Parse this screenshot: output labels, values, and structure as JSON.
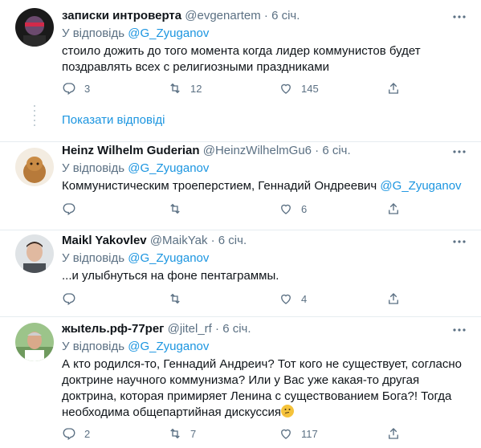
{
  "tweets": [
    {
      "name": "записки интроверта",
      "handle": "@evgenartem",
      "time": "6 січ.",
      "reply_prefix": "У відповідь",
      "reply_to": "@G_Zyuganov",
      "text_lines": [
        "стоило дожить до того момента когда лидер коммунистов будет",
        "поздравлять всех с религиозными праздниками"
      ],
      "replies": "3",
      "retweets": "12",
      "likes": "145"
    },
    {
      "name": "Heinz Wilhelm Guderian",
      "handle": "@HeinzWilhelmGu6",
      "time": "6 січ.",
      "reply_prefix": "У відповідь",
      "reply_to": "@G_Zyuganov",
      "text_lines": [
        "Коммунистическим троеперстием,  Геннадий Ондреевич "
      ],
      "text_mention": "@G_Zyuganov",
      "replies": "",
      "retweets": "",
      "likes": "6"
    },
    {
      "name": "Maikl Yakovlev",
      "handle": "@MaikYak",
      "time": "6 січ.",
      "reply_prefix": "У відповідь",
      "reply_to": "@G_Zyuganov",
      "text_lines": [
        "...и улыбнуться на фоне пентаграммы."
      ],
      "replies": "",
      "retweets": "",
      "likes": "4"
    },
    {
      "name": "жыtель.рф-77рег",
      "handle": "@jitel_rf",
      "time": "6 січ.",
      "reply_prefix": "У відповідь",
      "reply_to": "@G_Zyuganov",
      "text_lines": [
        "А кто родился-то, Геннадий Андреич? Тот кого не существует, согласно",
        "доктрине научного коммунизма? Или у Вас уже какая-то другая",
        "доктрина, которая примиряет Ленина с существованием Бога?! Тогда",
        "необходима общепартийная дискуссия"
      ],
      "replies": "2",
      "retweets": "7",
      "likes": "117"
    }
  ],
  "show_replies_label": "Показати відповіді",
  "icons": [
    "reply-icon",
    "retweet-icon",
    "like-icon",
    "share-icon",
    "more-icon",
    "thinking-emoji"
  ],
  "colors": {
    "link": "#1b95e0",
    "muted": "#5b7083",
    "text": "#0f1419",
    "divider": "#e6ecf0"
  }
}
